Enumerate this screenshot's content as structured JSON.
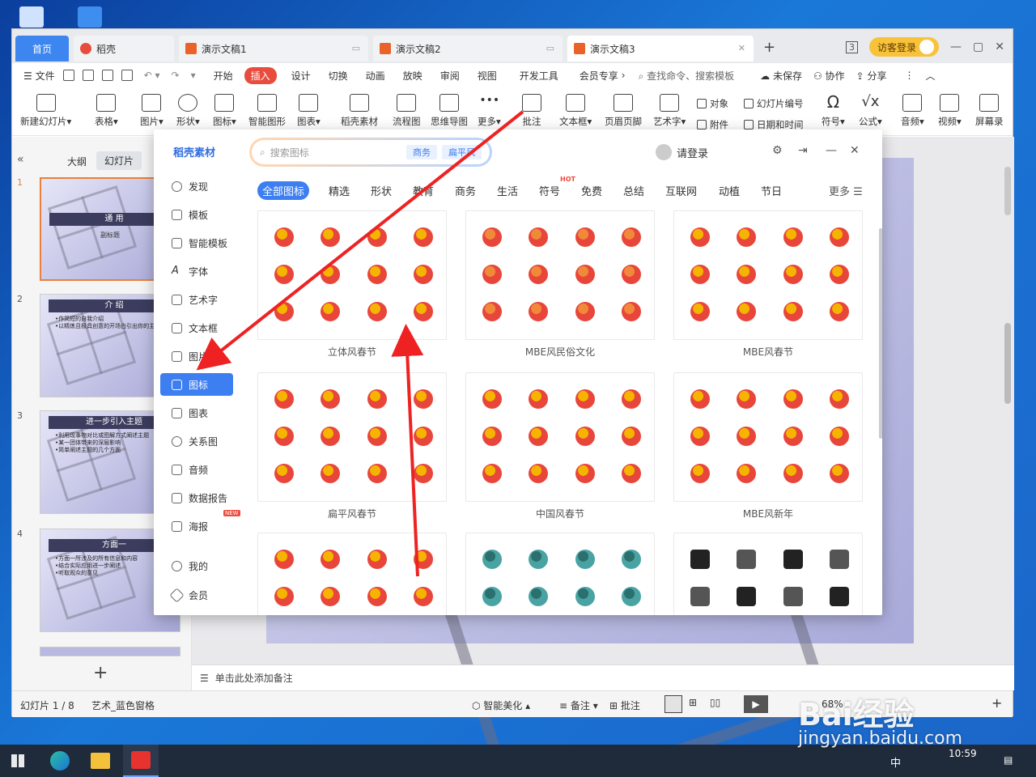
{
  "tabs": {
    "home": "首页",
    "daoke": "稻壳",
    "doc1": "演示文稿1",
    "doc2": "演示文稿2",
    "doc3": "演示文稿3",
    "visitor": "访客登录"
  },
  "menu": {
    "file": "文件",
    "items": [
      "开始",
      "插入",
      "设计",
      "切换",
      "动画",
      "放映",
      "审阅",
      "视图",
      "开发工具",
      "会员专享"
    ],
    "search": "查找命令、搜索模板",
    "unsaved": "未保存",
    "collab": "协作",
    "share": "分享"
  },
  "ribbon": {
    "new_slide": "新建幻灯片",
    "table": "表格",
    "picture": "图片",
    "shape": "形状",
    "icon": "图标",
    "smart": "智能图形",
    "chart": "图表",
    "material": "稻壳素材",
    "flow": "流程图",
    "mind": "思维导图",
    "more": "更多",
    "comment": "批注",
    "textbox": "文本框",
    "header": "页眉页脚",
    "art": "艺术字",
    "object": "对象",
    "slide_no": "幻灯片编号",
    "attach": "附件",
    "datetime": "日期和时间",
    "symbol": "符号",
    "formula": "公式",
    "audio": "音频",
    "video": "视频",
    "record": "屏幕录"
  },
  "leftpane": {
    "outline": "大纲",
    "slides": "幻灯片",
    "thumbs": [
      {
        "no": "1",
        "title": "通 用",
        "sub": "副标题",
        "lines": []
      },
      {
        "no": "2",
        "title": "介 绍",
        "lines": [
          "•作简短的自我介绍",
          "•以精炼且极具创意的开场白引出你的主题"
        ]
      },
      {
        "no": "3",
        "title": "进一步引入主题",
        "lines": [
          "•利用现事物对比或图解方式阐述主题",
          "•某一团体带来的深层影响",
          "•简单阐述主题的几个方面"
        ]
      },
      {
        "no": "4",
        "title": "方面一",
        "lines": [
          "•方面一所涉及的所有信息和内容",
          "•结合实际应用进一步阐述",
          "•听取观众的意见"
        ]
      }
    ]
  },
  "notes": "单击此处添加备注",
  "status": {
    "slide": "幻灯片 1 / 8",
    "theme": "艺术_蓝色窗格",
    "beautify": "智能美化",
    "remark": "备注",
    "comment": "批注",
    "zoom": "68%"
  },
  "panel": {
    "logo": "稻壳素材",
    "search_placeholder": "搜索图标",
    "chip1": "商务",
    "chip2": "扁平风",
    "login": "请登录",
    "nav": [
      "发现",
      "模板",
      "智能模板",
      "字体",
      "艺术字",
      "文本框",
      "图片",
      "图标",
      "图表",
      "关系图",
      "音频",
      "数据报告",
      "海报",
      "我的",
      "会员"
    ],
    "new_badge": "NEW",
    "cats": [
      "全部图标",
      "精选",
      "形状",
      "教育",
      "商务",
      "生活",
      "符号",
      "免费",
      "总结",
      "互联网",
      "动植",
      "节日"
    ],
    "hot": "HOT",
    "more": "更多",
    "cards": [
      "立体风春节",
      "MBE风民俗文化",
      "MBE风春节",
      "扁平风春节",
      "中国风春节",
      "MBE风新年"
    ]
  },
  "taskbar": {
    "time": "10:59",
    "ime": "中"
  },
  "watermark": {
    "brand": "Bai经验",
    "url": "jingyan.baidu.com"
  },
  "colors": {
    "accent": "#3d7ef0",
    "brand_red": "#e84c3d",
    "arrow": "#ee2222",
    "icon_red": "#e8463a",
    "icon_gold": "#f4b400",
    "icon_teal": "#4aa3a3"
  }
}
